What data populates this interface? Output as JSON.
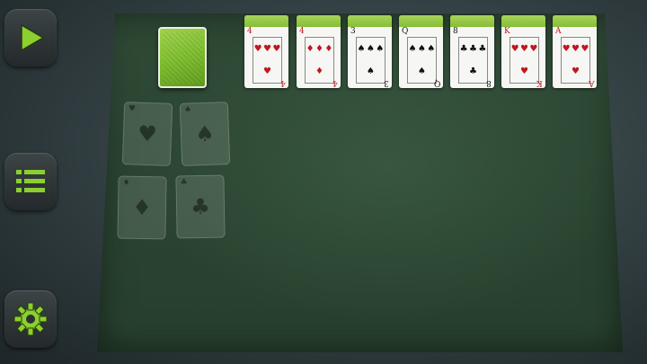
{
  "sidebar": {
    "buttons": [
      {
        "name": "play",
        "icon": "play-icon"
      },
      {
        "name": "menu",
        "icon": "menu-icon"
      },
      {
        "name": "settings",
        "icon": "gear-icon"
      }
    ]
  },
  "colors": {
    "accent": "#8ccf2e",
    "table": "#2b4532"
  },
  "stock": {
    "card_back": "green"
  },
  "foundations": [
    {
      "suit": "♥",
      "color": "red"
    },
    {
      "suit": "♠",
      "color": "black"
    },
    {
      "suit": "♦",
      "color": "red"
    },
    {
      "suit": "♣",
      "color": "black"
    }
  ],
  "tableau": [
    {
      "rank": "4",
      "suit": "♥",
      "color": "red"
    },
    {
      "rank": "4",
      "suit": "♦",
      "color": "red"
    },
    {
      "rank": "3",
      "suit": "♠",
      "color": "black"
    },
    {
      "rank": "Q",
      "suit": "♠",
      "color": "black"
    },
    {
      "rank": "8",
      "suit": "♣",
      "color": "black"
    },
    {
      "rank": "K",
      "suit": "♥",
      "color": "red"
    },
    {
      "rank": "A",
      "suit": "♥",
      "color": "red"
    }
  ]
}
